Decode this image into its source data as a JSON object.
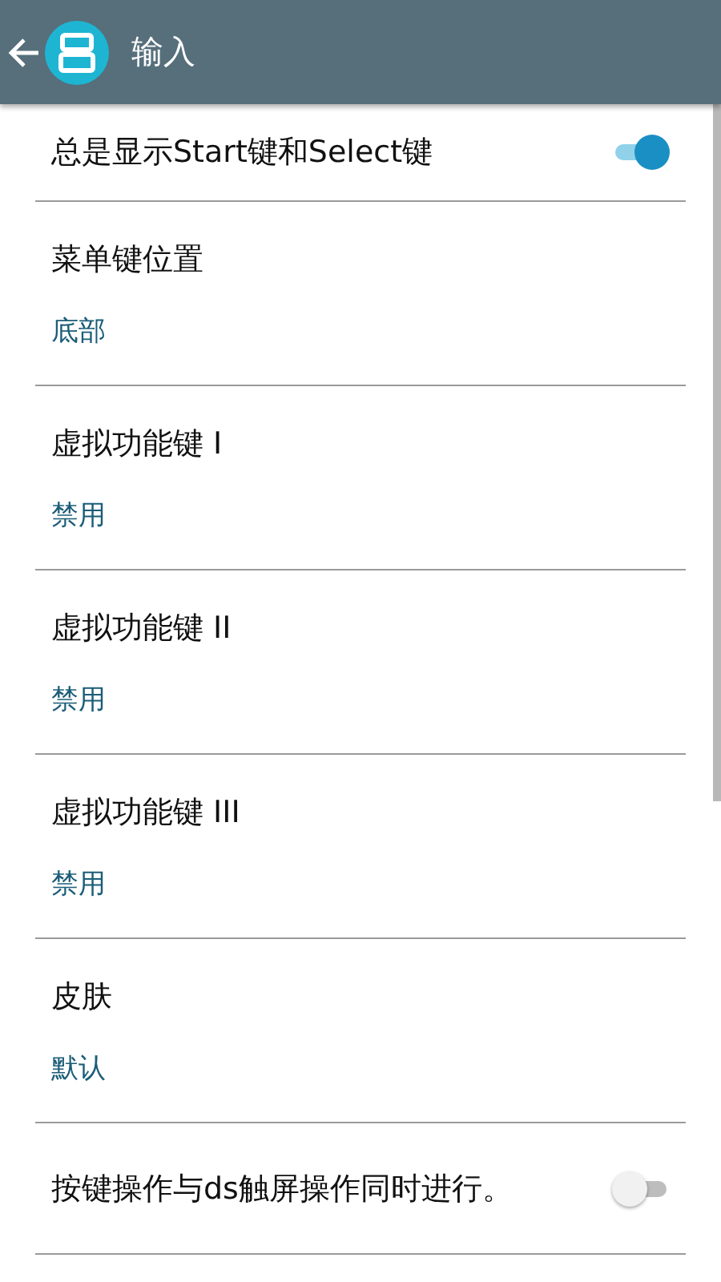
{
  "app_bar": {
    "title": "输入"
  },
  "settings": [
    {
      "kind": "switch",
      "title": "总是显示Start键和Select键",
      "on": true
    },
    {
      "kind": "choice",
      "title": "菜单键位置",
      "value": "底部"
    },
    {
      "kind": "choice",
      "title": "虚拟功能键 I",
      "value": "禁用"
    },
    {
      "kind": "choice",
      "title": "虚拟功能键 II",
      "value": "禁用"
    },
    {
      "kind": "choice",
      "title": "虚拟功能键 III",
      "value": "禁用"
    },
    {
      "kind": "choice",
      "title": "皮肤",
      "value": "默认"
    },
    {
      "kind": "switch",
      "title": "按键操作与ds触屏操作同时进行。",
      "on": false
    }
  ]
}
